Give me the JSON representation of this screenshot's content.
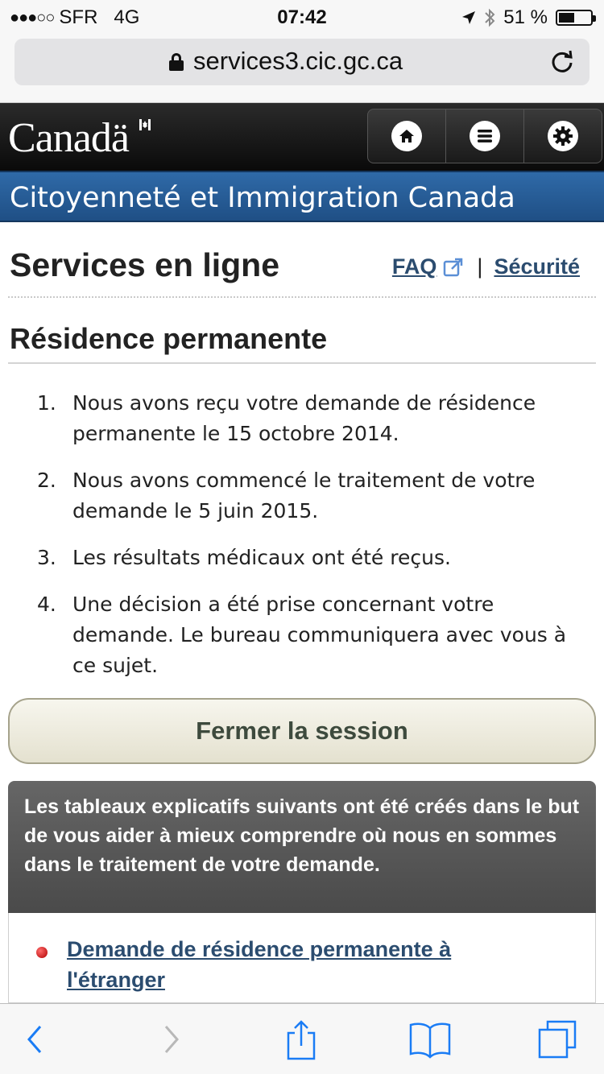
{
  "status_bar": {
    "signal": "●●●○○",
    "carrier": "SFR",
    "network": "4G",
    "time": "07:42",
    "battery_percent_text": "51 %",
    "battery_level": 0.51
  },
  "browser": {
    "url": "services3.cic.gc.ca",
    "lock_icon": "lock-icon",
    "reload_icon": "reload-icon"
  },
  "header": {
    "wordmark": "Canadä",
    "nav_icons": [
      "home-icon",
      "menu-icon",
      "settings-gear-icon"
    ]
  },
  "department": {
    "title": "Citoyenneté et Immigration Canada"
  },
  "main": {
    "page_title": "Services en ligne",
    "faq_label": "FAQ",
    "separator": "|",
    "security_label": "Sécurité",
    "section_title": "Résidence permanente",
    "status_items": [
      {
        "num": "1.",
        "text": "Nous avons reçu votre demande de résidence permanente le 15 octobre 2014."
      },
      {
        "num": "2.",
        "text": "Nous avons commencé le traitement de votre demande le 5 juin 2015."
      },
      {
        "num": "3.",
        "text": "Les résultats médicaux ont été reçus."
      },
      {
        "num": "4.",
        "text": "Une décision a été prise concernant votre demande. Le bureau communiquera avec vous à ce sujet."
      }
    ],
    "logout_label": "Fermer la session",
    "info_text": "Les tableaux explicatifs suivants ont été créés dans le but de vous aider à mieux comprendre où nous en sommes dans le traitement de votre demande.",
    "link_text": "Demande de résidence permanente à l'étranger"
  },
  "toolbar": {
    "icons": [
      "back-icon",
      "forward-icon",
      "share-icon",
      "bookmarks-icon",
      "tabs-icon"
    ]
  },
  "colors": {
    "header_bg": "#111111",
    "banner_blue": "#2f6aa8",
    "link_blue": "#2b4c6f",
    "ios_blue": "#1a7cf5",
    "button_beige": "#e4e1cf"
  }
}
